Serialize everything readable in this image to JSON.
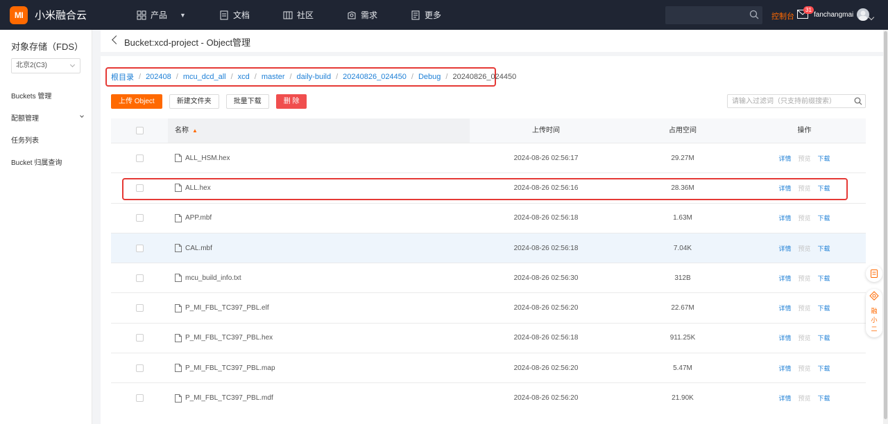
{
  "topbar": {
    "logo_mark": "MI",
    "logo_text": "小米融合云",
    "nav": [
      {
        "label": "产品",
        "icon": "grid-icon",
        "has_caret": true
      },
      {
        "label": "文档",
        "icon": "document-icon"
      },
      {
        "label": "社区",
        "icon": "community-icon"
      },
      {
        "label": "需求",
        "icon": "request-icon"
      },
      {
        "label": "更多",
        "icon": "more-icon"
      }
    ],
    "search_placeholder": "",
    "console_label": "控制台",
    "mail_badge": "31",
    "username": "fanchangmai"
  },
  "sidebar": {
    "title": "对象存储（FDS）",
    "region": "北京2(C3)",
    "items": [
      {
        "label": "Buckets 管理"
      },
      {
        "label": "配额管理",
        "has_caret": true
      },
      {
        "label": "任务列表"
      },
      {
        "label": "Bucket 归属查询"
      }
    ]
  },
  "page": {
    "title": "Bucket:xcd-project - Object管理"
  },
  "breadcrumb": [
    "根目录",
    "202408",
    "mcu_dcd_all",
    "xcd",
    "master",
    "daily-build",
    "20240826_024450",
    "Debug",
    "20240826_024450"
  ],
  "toolbar": {
    "upload": "上传 Object",
    "new_folder": "新建文件夹",
    "batch_download": "批量下载",
    "delete": "删 除",
    "filter_placeholder": "请输入过滤词（只支持前缀搜索）"
  },
  "table": {
    "headers": {
      "name": "名称",
      "time": "上传时间",
      "size": "占用空间",
      "ops": "操作"
    },
    "ops": {
      "detail": "详情",
      "preview": "预览",
      "download": "下载"
    },
    "rows": [
      {
        "name": "ALL_HSM.hex",
        "time": "2024-08-26 02:56:17",
        "size": "29.27M"
      },
      {
        "name": "ALL.hex",
        "time": "2024-08-26 02:56:16",
        "size": "28.36M",
        "highlighted": true
      },
      {
        "name": "APP.mbf",
        "time": "2024-08-26 02:56:18",
        "size": "1.63M"
      },
      {
        "name": "CAL.mbf",
        "time": "2024-08-26 02:56:18",
        "size": "7.04K",
        "hover": true
      },
      {
        "name": "mcu_build_info.txt",
        "time": "2024-08-26 02:56:30",
        "size": "312B"
      },
      {
        "name": "P_MI_FBL_TC397_PBL.elf",
        "time": "2024-08-26 02:56:20",
        "size": "22.67M"
      },
      {
        "name": "P_MI_FBL_TC397_PBL.hex",
        "time": "2024-08-26 02:56:18",
        "size": "911.25K"
      },
      {
        "name": "P_MI_FBL_TC397_PBL.map",
        "time": "2024-08-26 02:56:20",
        "size": "5.47M"
      },
      {
        "name": "P_MI_FBL_TC397_PBL.mdf",
        "time": "2024-08-26 02:56:20",
        "size": "21.90K"
      }
    ]
  },
  "float_helper": {
    "chars": [
      "融",
      "小",
      "二"
    ]
  },
  "colors": {
    "brand": "#ff6900",
    "link": "#1d7fd6",
    "danger": "#f04e4e",
    "topbar": "#1f2533"
  }
}
